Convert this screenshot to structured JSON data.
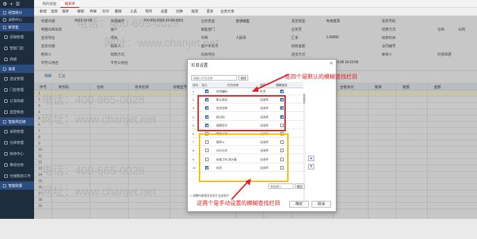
{
  "sidebar": {
    "top_icons": [
      "⚙",
      "+",
      "☰"
    ],
    "items": [
      {
        "label": "经营统计",
        "type": "sec"
      },
      {
        "label": "采购中心",
        "type": "item"
      },
      {
        "label": "新零售",
        "type": "sec"
      },
      {
        "label": "促销管理",
        "type": "sub"
      },
      {
        "label": "智能门店",
        "type": "sub"
      },
      {
        "label": "商城",
        "type": "sub"
      },
      {
        "label": "批发",
        "type": "sec"
      },
      {
        "label": "选证管理",
        "type": "sub"
      },
      {
        "label": "门店管理",
        "type": "sub"
      },
      {
        "label": "订货商城",
        "type": "sub"
      },
      {
        "label": "直营物流",
        "type": "sub"
      },
      {
        "label": "智能供应链",
        "type": "sec"
      },
      {
        "label": "采购管理",
        "type": "sub"
      },
      {
        "label": "仓库管理",
        "type": "sub"
      },
      {
        "label": "库存中心",
        "type": "sub"
      },
      {
        "label": "移动仓库",
        "type": "sub"
      },
      {
        "label": "仓储物流工作",
        "type": "sub"
      },
      {
        "label": "智能财报",
        "type": "sec"
      }
    ]
  },
  "tabs": [
    "我的桌面",
    "销货单"
  ],
  "toolbar": [
    "新增",
    "选单",
    "保存",
    "审核",
    "弃审",
    "打印",
    "删除",
    "工具",
    "附件",
    "设置",
    "切换",
    "批改",
    "更多",
    "业务分享"
  ],
  "form": {
    "row1": [
      [
        "单据日期",
        "2023-10-08"
      ],
      [
        "单据编号",
        "PX-000-2023-10-08-0001"
      ],
      [
        "业务类型",
        "普通销售"
      ],
      [
        "发票类型",
        "专用发票"
      ],
      [
        "发票号码",
        ""
      ]
    ],
    "row2": [
      [
        "电路出库状态",
        ""
      ],
      [
        "客户",
        ""
      ],
      [
        "销售部门",
        ""
      ],
      [
        "业务员",
        ""
      ],
      [
        "结算方式",
        ""
      ],
      [
        "仓库",
        "公共"
      ]
    ],
    "row3": [
      [
        "送货地址",
        ""
      ],
      [
        "项目",
        ""
      ],
      [
        "币种",
        "人民币"
      ],
      [
        "汇率",
        "1.00000"
      ],
      [
        "收款科目",
        ""
      ]
    ],
    "row4": [
      [
        "送货日期",
        ""
      ],
      [
        "联系人",
        ""
      ],
      [
        "客户手机号",
        ""
      ],
      [
        "收款金额",
        ""
      ],
      [
        "合同编号",
        ""
      ]
    ],
    "row5": [
      [
        "制单人",
        ""
      ],
      [
        "收款方式",
        ""
      ],
      [
        "出库地址",
        ""
      ],
      [
        "送货方式",
        ""
      ],
      [
        "审核人",
        ""
      ],
      [
        "外部单据",
        ""
      ]
    ],
    "row6": [
      [
        "字符公用自",
        ""
      ],
      [
        "字符公用自",
        ""
      ],
      [
        "字符公用自",
        ""
      ],
      [
        "制单日期",
        "2023-10-08 16:20:56"
      ]
    ]
  },
  "subtabs": [
    "明细",
    "汇总"
  ],
  "grid": {
    "headers": [
      "序号",
      "条形码",
      "仓库",
      "存货名称",
      "规格型号",
      "数量",
      "单位",
      "销售单价",
      "含税单价",
      "税率",
      "税额",
      "金额"
    ],
    "rows": [
      "1",
      "2",
      "3",
      "4",
      "5",
      "6",
      "7",
      "8",
      "9",
      "10",
      "11",
      "12",
      "13",
      "14",
      "15",
      "16",
      "17",
      "18",
      "19"
    ]
  },
  "watermark": {
    "phone": "400-665-0028",
    "site": "www.chanjet.net",
    "tel_label": "电话：",
    "web_label": "网址："
  },
  "dialog": {
    "title": "栏目设置",
    "search_placeholder": "请输入栏目名称",
    "find_label": "查找",
    "headers": [
      "排号",
      "显示",
      "栏目名称",
      "排序",
      "模糊查找"
    ],
    "rows": [
      {
        "no": "1",
        "show": true,
        "name": "存货编码",
        "sort": "升序",
        "fuzzy": true
      },
      {
        "no": "2",
        "show": true,
        "name": "默认条码",
        "sort": "无排序",
        "fuzzy": true
      },
      {
        "no": "3",
        "show": true,
        "name": "存货名称",
        "sort": "无排序",
        "fuzzy": true
      },
      {
        "no": "4",
        "show": true,
        "name": "助记码",
        "sort": "无排序",
        "fuzzy": true
      },
      {
        "no": "5",
        "show": true,
        "name": "规格型号",
        "sort": "无排序",
        "fuzzy": false
      },
      {
        "no": "6",
        "show": false,
        "name": "零售价格",
        "sort": "无排序",
        "fuzzy": false
      },
      {
        "no": "7",
        "show": false,
        "name": "税率%",
        "sort": "无排序",
        "fuzzy": false
      },
      {
        "no": "8",
        "show": false,
        "name": "计价方式",
        "sort": "无排序",
        "fuzzy": false
      },
      {
        "no": "9",
        "show": false,
        "name": "标准工时-流计量",
        "sort": "无排序",
        "fuzzy": false
      },
      {
        "no": "10",
        "show": true,
        "name": "存货",
        "sort": "无排序",
        "fuzzy": false
      }
    ],
    "arrow_up": "▲",
    "arrow_down": "▼",
    "pos_placeholder": "数据输入",
    "pos_btn": "确定",
    "hint": "☐ 调整列表是否应用于全部用户",
    "confirm": "确定",
    "cancel": "取消",
    "close": "✕"
  },
  "annotations": {
    "top": "这四个是默认的模糊查找栏目",
    "bottom": "这两个是手动设置的模糊查找栏目",
    "color": "#e02020"
  }
}
